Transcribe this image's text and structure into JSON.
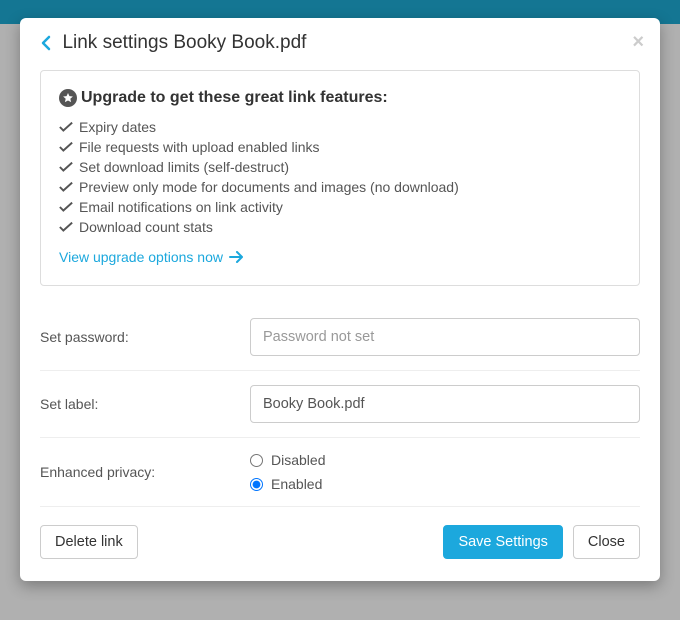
{
  "modal": {
    "title": "Link settings Booky Book.pdf",
    "upgrade_panel": {
      "heading": "Upgrade to get these great link features:",
      "features": [
        "Expiry dates",
        "File requests with upload enabled links",
        "Set download limits (self-destruct)",
        "Preview only mode for documents and images (no download)",
        "Email notifications on link activity",
        "Download count stats"
      ],
      "cta": "View upgrade options now"
    },
    "fields": {
      "password_label": "Set password:",
      "password_placeholder": "Password not set",
      "password_value": "",
      "label_label": "Set label:",
      "label_value": "Booky Book.pdf",
      "privacy_label": "Enhanced privacy:",
      "privacy_disabled": "Disabled",
      "privacy_enabled": "Enabled",
      "privacy_selected": "enabled"
    },
    "buttons": {
      "delete": "Delete link",
      "save": "Save Settings",
      "close": "Close"
    }
  }
}
